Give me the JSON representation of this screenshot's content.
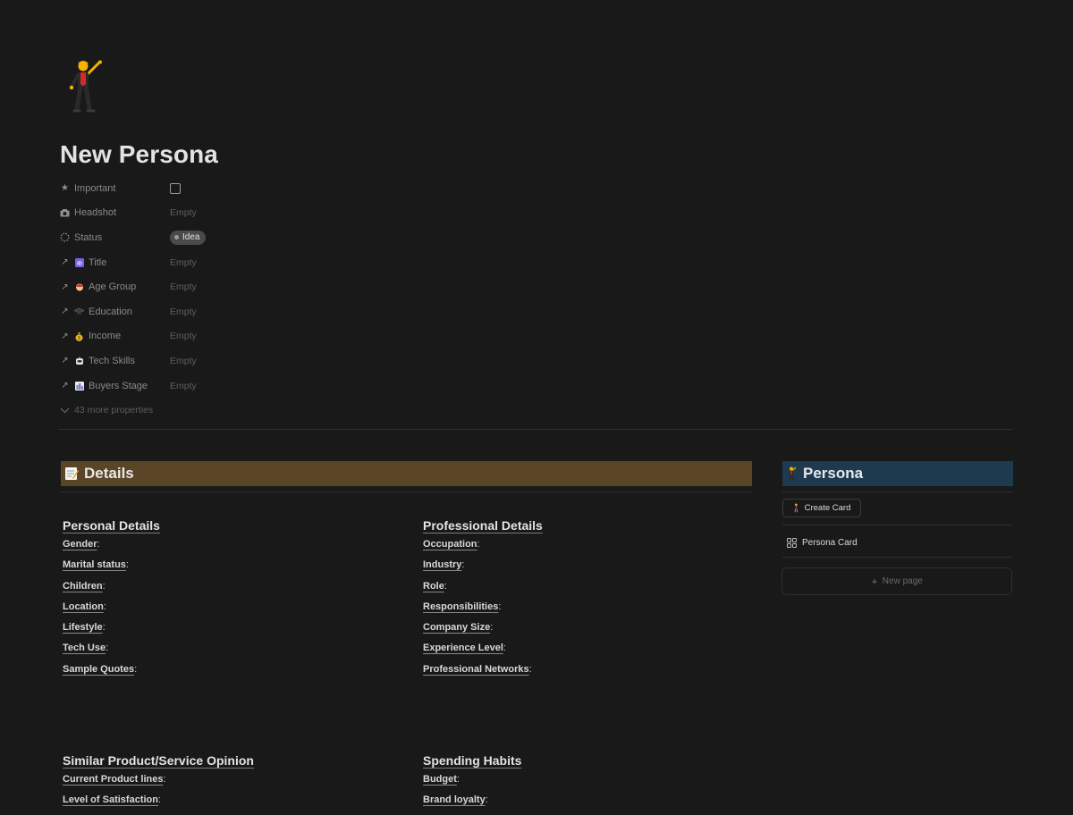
{
  "page": {
    "icon": "person-dancing-emoji",
    "title": "New Persona"
  },
  "properties": [
    {
      "icon": "star-icon",
      "name": "Important",
      "type": "checkbox",
      "value": ""
    },
    {
      "icon": "camera-icon",
      "name": "Headshot",
      "type": "text",
      "value": "Empty"
    },
    {
      "icon": "status-icon",
      "name": "Status",
      "type": "status",
      "value": "Idea"
    },
    {
      "icon": "id-emoji",
      "name": "Title",
      "type": "relation",
      "value": "Empty"
    },
    {
      "icon": "baby-emoji",
      "name": "Age Group",
      "type": "relation",
      "value": "Empty"
    },
    {
      "icon": "graduation-cap-emoji",
      "name": "Education",
      "type": "relation",
      "value": "Empty"
    },
    {
      "icon": "money-bag-emoji",
      "name": "Income",
      "type": "relation",
      "value": "Empty"
    },
    {
      "icon": "robot-emoji",
      "name": "Tech Skills",
      "type": "relation",
      "value": "Empty"
    },
    {
      "icon": "chart-emoji",
      "name": "Buyers Stage",
      "type": "relation",
      "value": "Empty"
    }
  ],
  "more_properties": "43 more properties",
  "details": {
    "header": "Details",
    "icon": "memo-emoji",
    "header_color": "#5a4527"
  },
  "sections": {
    "personal": {
      "title": "Personal Details",
      "fields": [
        "Gender",
        "Marital status",
        "Children",
        "Location",
        "Lifestyle",
        "Tech Use",
        "Sample Quotes"
      ]
    },
    "professional": {
      "title": "Professional Details",
      "fields": [
        "Occupation",
        "Industry",
        "Role",
        "Responsibilities",
        "Company Size",
        "Experience Level",
        "Professional Networks"
      ]
    },
    "opinion": {
      "title": "Similar Product/Service Opinion",
      "fields": [
        "Current Product lines",
        "Level of Satisfaction"
      ]
    },
    "spending": {
      "title": "Spending Habits",
      "fields": [
        "Budget",
        "Brand loyalty"
      ]
    }
  },
  "field_suffix": ":",
  "persona_panel": {
    "header": "Persona",
    "header_color": "#1e3a4f",
    "create_card": "Create Card",
    "view_name": "Persona Card",
    "new_page": "New page"
  }
}
